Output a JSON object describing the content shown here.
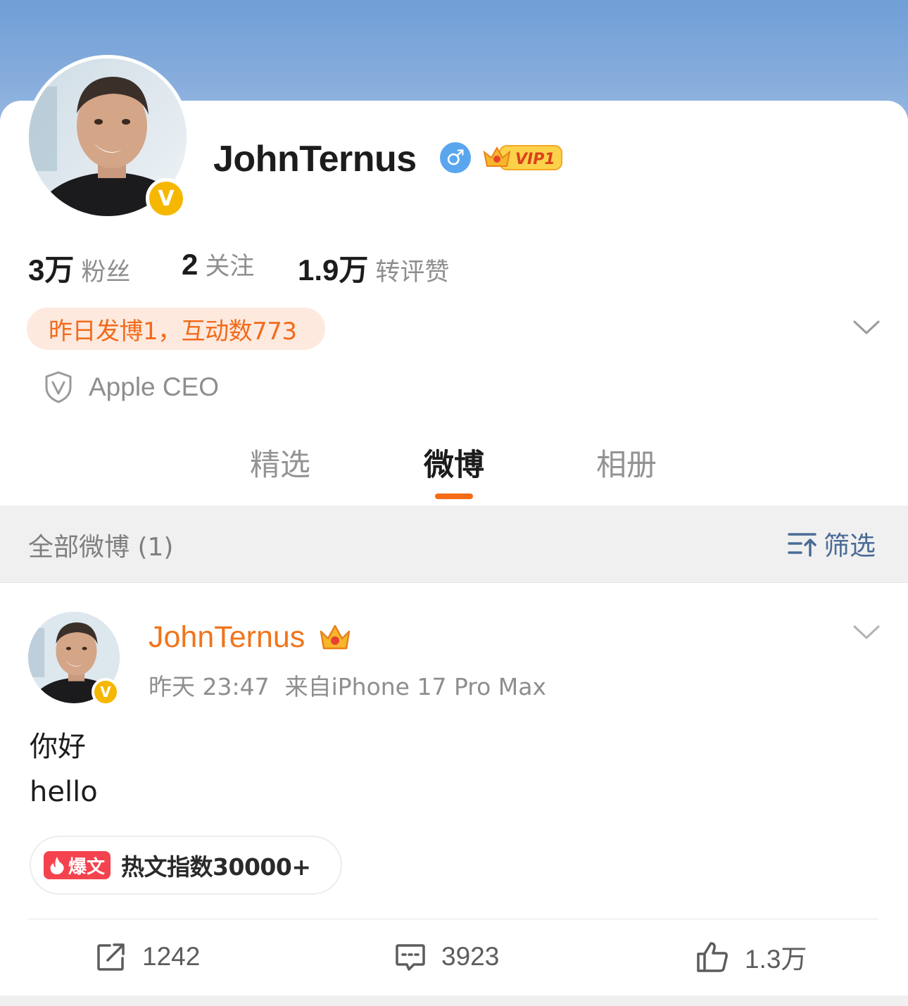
{
  "profile": {
    "name": "JohnTernus",
    "gender_symbol": "♂",
    "vip_label": "VIP1",
    "verified_mark": "V",
    "stats": [
      {
        "value": "3万",
        "label": "粉丝"
      },
      {
        "value": "2",
        "label": "关注"
      },
      {
        "value": "1.9万",
        "label": "转评赞"
      }
    ],
    "activity": "昨日发博1，互动数773",
    "certification": "Apple CEO"
  },
  "tabs": [
    {
      "label": "精选"
    },
    {
      "label": "微博"
    },
    {
      "label": "相册"
    }
  ],
  "active_tab": "微博",
  "filter_bar": {
    "title": "全部微博 (1)",
    "filter_label": "筛选"
  },
  "post": {
    "author": "JohnTernus",
    "verified_mark": "V",
    "time": "昨天 23:47",
    "source": "来自iPhone 17 Pro Max",
    "text_lines": [
      "你好",
      "hello"
    ],
    "hot_tag": "爆文",
    "hot_text": "热文指数30000+",
    "actions": {
      "repost": "1242",
      "comment": "3923",
      "like": "1.3万"
    }
  },
  "colors": {
    "accent": "#f56b16",
    "name_orange": "#f0751b",
    "pill_bg": "#fde9de",
    "verified_gold": "#f5b700",
    "filter_blue": "#4a6b96"
  },
  "icons": [
    "gender-male-icon",
    "vip-crown-icon",
    "verified-v-icon",
    "chevron-down-icon",
    "shield-v-icon",
    "filter-sort-icon",
    "crown-icon",
    "fire-icon",
    "repost-icon",
    "comment-icon",
    "like-icon"
  ]
}
